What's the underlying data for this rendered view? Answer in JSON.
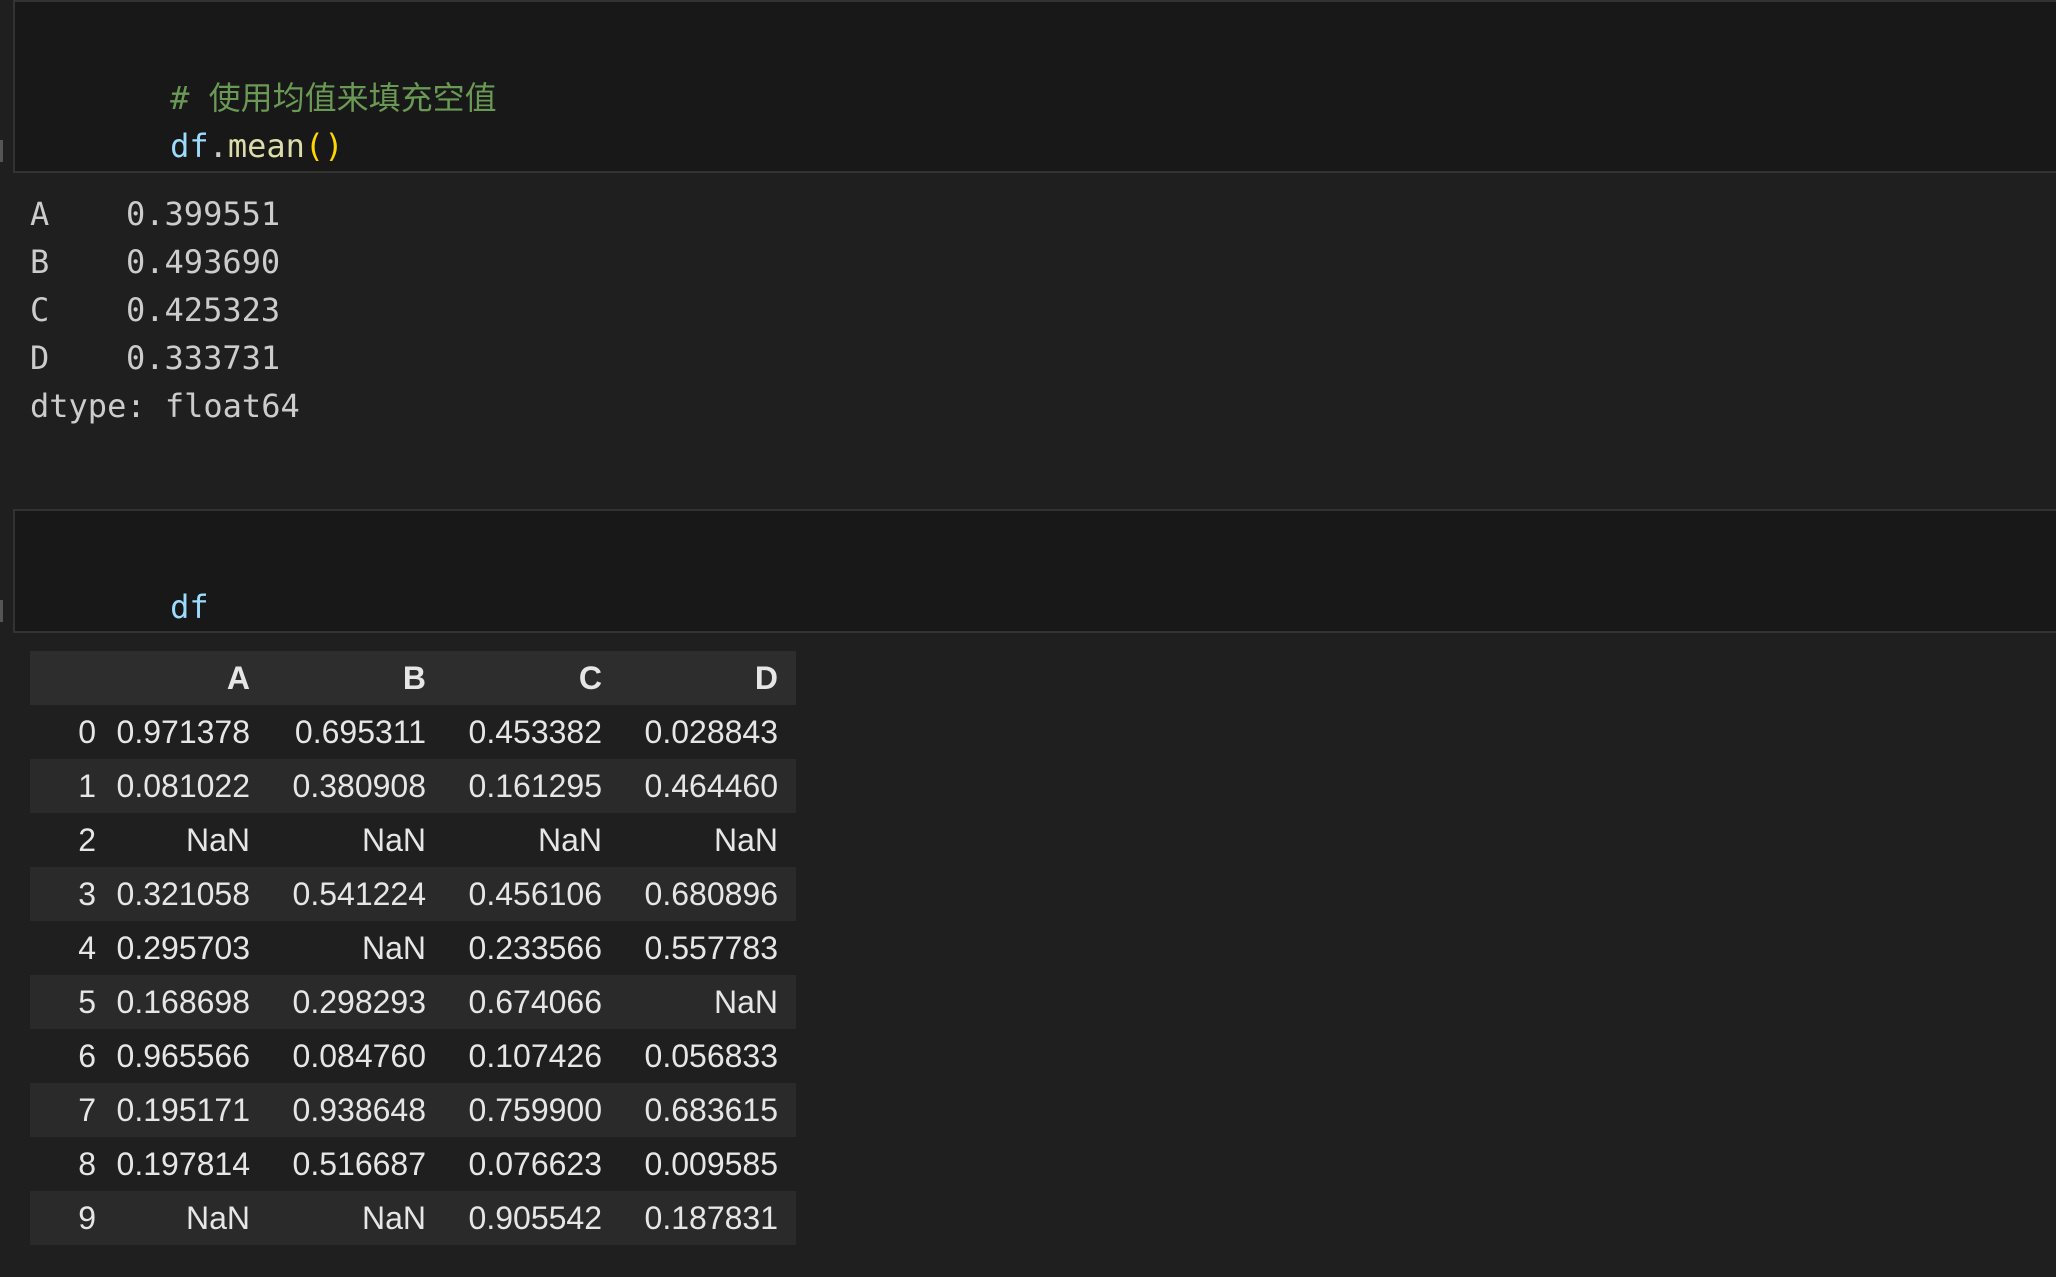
{
  "cells": [
    {
      "comment": "# 使用均值来填充空值",
      "code": {
        "var": "df",
        "dot": ".",
        "fn": "mean",
        "paren": "()"
      }
    },
    {
      "code": {
        "var": "df"
      }
    }
  ],
  "mean_output": {
    "rows": [
      {
        "index": "A",
        "value": "0.399551"
      },
      {
        "index": "B",
        "value": "0.493690"
      },
      {
        "index": "C",
        "value": "0.425323"
      },
      {
        "index": "D",
        "value": "0.333731"
      }
    ],
    "dtype_line": "dtype: float64"
  },
  "dataframe": {
    "columns": [
      "",
      "A",
      "B",
      "C",
      "D"
    ],
    "rows": [
      [
        "0",
        "0.971378",
        "0.695311",
        "0.453382",
        "0.028843"
      ],
      [
        "1",
        "0.081022",
        "0.380908",
        "0.161295",
        "0.464460"
      ],
      [
        "2",
        "NaN",
        "NaN",
        "NaN",
        "NaN"
      ],
      [
        "3",
        "0.321058",
        "0.541224",
        "0.456106",
        "0.680896"
      ],
      [
        "4",
        "0.295703",
        "NaN",
        "0.233566",
        "0.557783"
      ],
      [
        "5",
        "0.168698",
        "0.298293",
        "0.674066",
        "NaN"
      ],
      [
        "6",
        "0.965566",
        "0.084760",
        "0.107426",
        "0.056833"
      ],
      [
        "7",
        "0.195171",
        "0.938648",
        "0.759900",
        "0.683615"
      ],
      [
        "8",
        "0.197814",
        "0.516687",
        "0.076623",
        "0.009585"
      ],
      [
        "9",
        "NaN",
        "NaN",
        "0.905542",
        "0.187831"
      ]
    ]
  },
  "colors": {
    "background": "#1f1f1f",
    "cell_background": "#181818",
    "comment": "#6a9955",
    "variable": "#9cdcfe",
    "function": "#dcdcaa",
    "bracket": "#ffd700"
  }
}
